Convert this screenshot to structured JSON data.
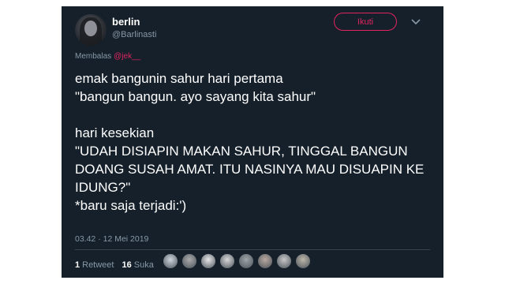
{
  "tweet": {
    "author_name": "berlin",
    "author_handle": "@Barlinasti",
    "follow_label": "Ikuti",
    "caret_icon": "chevron-down-icon",
    "reply_label": "Membalas",
    "reply_mention": "@jek__",
    "text": "emak bangunin sahur hari pertama\n\"bangun bangun. ayo sayang kita sahur\"\n\nhari kesekian\n\"UDAH DISIAPIN MAKAN SAHUR, TINGGAL BANGUN DOANG SUSAH AMAT. ITU NASINYA MAU DISUAPIN KE IDUNG?\"\n*baru saja terjadi:')",
    "timestamp": "03.42 · 12 Mei 2019",
    "retweet_count": "1",
    "retweet_label": "Retweet",
    "like_count": "16",
    "like_label": "Suka"
  },
  "colors": {
    "background": "#15202b",
    "accent": "#e0245e",
    "muted": "#8899a6"
  },
  "likers": [
    {
      "color": "#cfd6dd"
    },
    {
      "color": "#a9a9a9"
    },
    {
      "color": "#e8e8e8"
    },
    {
      "color": "#d8d8d8"
    },
    {
      "color": "#9ea4a8"
    },
    {
      "color": "#b8a8a0"
    },
    {
      "color": "#c7c7c7"
    },
    {
      "color": "#bdb6a8"
    }
  ]
}
